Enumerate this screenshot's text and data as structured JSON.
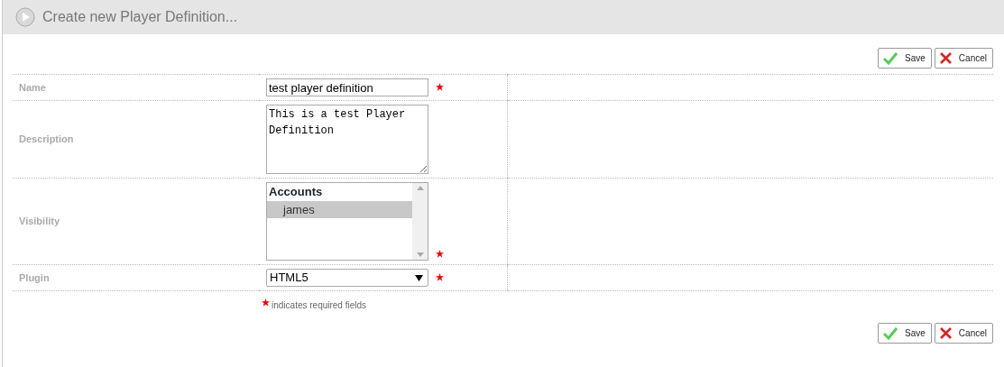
{
  "header": {
    "title": "Create new Player Definition..."
  },
  "top_buttons": [
    {
      "kind": "save",
      "label": "Save"
    },
    {
      "kind": "cancel",
      "label": "Cancel"
    }
  ],
  "fields": [
    {
      "kind": "text",
      "label": "Name",
      "value": "test player definition",
      "required": true
    },
    {
      "kind": "textarea",
      "label": "Description",
      "value": "This is a test Player Definition",
      "required": false
    },
    {
      "kind": "listbox",
      "label": "Visibility",
      "required": true,
      "group": "Accounts",
      "options": [
        {
          "label": "james",
          "selected": true
        }
      ]
    },
    {
      "kind": "select",
      "label": "Plugin",
      "value": "HTML5",
      "required": true
    }
  ],
  "note": "indicates required fields",
  "bottom_buttons": [
    {
      "kind": "save",
      "label": "Save"
    },
    {
      "kind": "cancel",
      "label": "Cancel"
    }
  ]
}
